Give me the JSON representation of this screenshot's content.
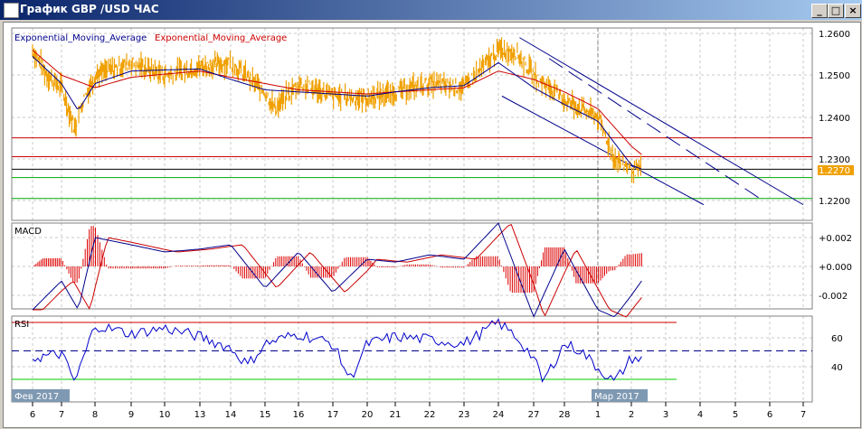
{
  "window": {
    "title": "График GBP /USD  ЧАС",
    "minimize": "_",
    "maximize": "□",
    "close": "×"
  },
  "main_pane": {
    "legend": [
      "Exponential_Moving_Average",
      "Exponential_Moving_Average"
    ],
    "legend_colors": [
      "#00008b",
      "#cc0000"
    ],
    "y_labels": [
      "1.2600",
      "1.2500",
      "1.2400",
      "1.2300",
      "1.2200"
    ],
    "current_price": "1.2270"
  },
  "macd_pane": {
    "label": "MACD",
    "y_labels": [
      "+0.002",
      "+0.000",
      "-0.002"
    ]
  },
  "rsi_pane": {
    "label": "RSI",
    "y_labels": [
      "60",
      "40"
    ]
  },
  "month_labels": [
    "Фев 2017",
    "Мар 2017"
  ],
  "x_labels": [
    "6",
    "7",
    "8",
    "9",
    "10",
    "13",
    "14",
    "15",
    "16",
    "17",
    "20",
    "21",
    "22",
    "23",
    "24",
    "27",
    "28",
    "1",
    "2",
    "3",
    "4",
    "5",
    "6",
    "7"
  ],
  "chart_data": {
    "type": "line",
    "price": {
      "t": [
        0,
        0.5,
        1,
        1.2,
        1.4,
        1.6,
        2,
        3,
        4,
        5,
        6,
        7,
        7.3,
        8,
        9,
        10,
        11,
        12,
        13,
        14,
        14.5,
        15,
        15.5,
        16,
        17,
        17.5,
        18,
        18.3
      ],
      "v": [
        1.256,
        1.25,
        1.247,
        1.242,
        1.237,
        1.243,
        1.25,
        1.253,
        1.25,
        1.252,
        1.253,
        1.246,
        1.242,
        1.248,
        1.245,
        1.2445,
        1.246,
        1.248,
        1.247,
        1.256,
        1.2555,
        1.25,
        1.247,
        1.244,
        1.24,
        1.23,
        1.2275,
        1.227
      ]
    },
    "ema_fast": {
      "t": [
        0,
        1,
        1.5,
        2,
        3,
        5,
        7,
        8,
        10,
        12,
        13,
        14,
        15,
        16,
        17,
        18,
        18.3
      ],
      "v": [
        1.2545,
        1.248,
        1.2415,
        1.248,
        1.251,
        1.2515,
        1.2465,
        1.246,
        1.245,
        1.247,
        1.2475,
        1.253,
        1.247,
        1.243,
        1.239,
        1.2285,
        1.2275
      ]
    },
    "ema_slow": {
      "t": [
        0,
        1,
        2,
        3,
        5,
        7,
        8,
        10,
        12,
        13,
        14,
        15,
        16,
        17,
        18,
        18.3
      ],
      "v": [
        1.256,
        1.25,
        1.247,
        1.2495,
        1.251,
        1.248,
        1.2465,
        1.2455,
        1.2465,
        1.247,
        1.251,
        1.249,
        1.246,
        1.242,
        1.233,
        1.231
      ]
    },
    "levels": [
      {
        "v": 1.235,
        "color": "#cc0000"
      },
      {
        "v": 1.2305,
        "color": "#cc0000"
      },
      {
        "v": 1.2275,
        "color": "#000000"
      },
      {
        "v": 1.2255,
        "color": "#00aa00"
      },
      {
        "v": 1.2205,
        "color": "#00aa00"
      }
    ],
    "channel": [
      {
        "from": [
          14.6,
          1.259
        ],
        "to": [
          23,
          1.219
        ],
        "dash": false
      },
      {
        "from": [
          15.5,
          1.254
        ],
        "to": [
          21.8,
          1.22
        ],
        "dash": true
      },
      {
        "from": [
          14.1,
          1.245
        ],
        "to": [
          20.1,
          1.219
        ],
        "dash": false
      }
    ],
    "macd": {
      "t": [
        0,
        1,
        1.5,
        2,
        3,
        4,
        5,
        6,
        7,
        8,
        9,
        10,
        11,
        12,
        13,
        14,
        15,
        16,
        17,
        17.5,
        18,
        18.3
      ],
      "v": [
        -0.003,
        -0.001,
        -0.003,
        0.002,
        0.0015,
        0.001,
        0.0012,
        0.0015,
        -0.0015,
        0.001,
        -0.0018,
        0.0005,
        0.0003,
        0.0008,
        0.0005,
        0.003,
        -0.0035,
        0.0012,
        -0.003,
        -0.0035,
        -0.002,
        -0.001
      ]
    },
    "rsi": {
      "t": [
        0,
        1,
        1.4,
        2,
        3,
        4,
        5,
        6,
        6.5,
        7,
        8,
        9,
        9.5,
        10,
        11,
        12,
        13,
        14,
        14.5,
        15,
        15.3,
        16,
        16.5,
        17,
        17.5,
        18,
        18.3
      ],
      "v": [
        45,
        48,
        28,
        68,
        62,
        66,
        60,
        52,
        40,
        55,
        62,
        55,
        30,
        55,
        60,
        58,
        55,
        70,
        60,
        45,
        28,
        55,
        50,
        38,
        28,
        45,
        44
      ]
    },
    "rsi_levels": [
      70,
      50,
      30
    ]
  }
}
